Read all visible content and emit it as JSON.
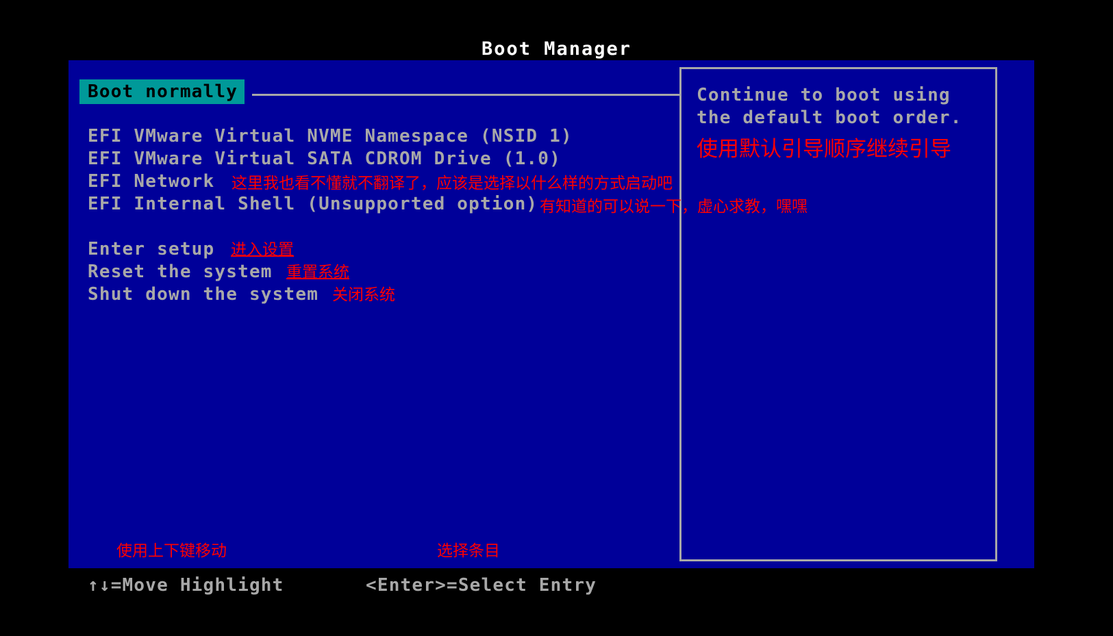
{
  "title": "Boot Manager",
  "menu": {
    "selected_index": 0,
    "items": [
      {
        "label": "Boot normally",
        "selected": true
      },
      {
        "label": "EFI VMware Virtual NVME Namespace (NSID 1)",
        "selected": false
      },
      {
        "label": "EFI VMware Virtual SATA CDROM Drive (1.0)",
        "selected": false
      },
      {
        "label": "EFI Network",
        "selected": false
      },
      {
        "label": "EFI Internal Shell (Unsupported option)",
        "selected": false
      },
      {
        "label": "Enter setup",
        "selected": false
      },
      {
        "label": "Reset the system",
        "selected": false
      },
      {
        "label": "Shut down the system",
        "selected": false
      }
    ]
  },
  "help": {
    "line1": "Continue to boot using",
    "line2": "the default boot order.",
    "annotation": "使用默认引导顺序继续引导"
  },
  "annotations": {
    "network_note": "这里我也看不懂就不翻译了，应该是选择以什么样的方式启动吧",
    "shell_note": "有知道的可以说一下，虚心求教，嘿嘿",
    "enter_setup": "进入设置",
    "reset_system": "重置系统",
    "shut_down": "关闭系统",
    "move_keys": "使用上下键移动",
    "select_entry": "选择条目"
  },
  "status_bar": {
    "move": "↑↓=Move Highlight",
    "select": "<Enter>=Select Entry"
  },
  "colors": {
    "background": "#000000",
    "panel": "#000099",
    "highlight": "#009999",
    "text": "#a8a8a8",
    "title_text": "#ffffff",
    "annotation": "#ff0000"
  }
}
